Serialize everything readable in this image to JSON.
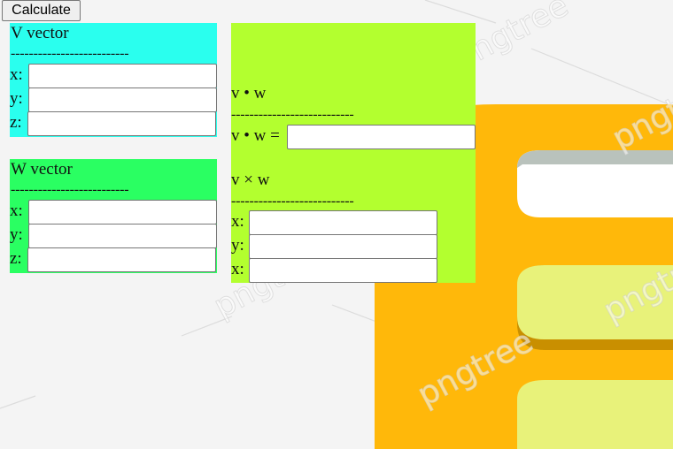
{
  "toolbar": {
    "calculate_label": "Calculate"
  },
  "v_vector": {
    "title": "V vector",
    "divider": "--------------------------",
    "fields": [
      {
        "label": "x:",
        "value": ""
      },
      {
        "label": "y:",
        "value": ""
      },
      {
        "label": "z:",
        "value": ""
      }
    ]
  },
  "w_vector": {
    "title": "W vector",
    "divider": "--------------------------",
    "fields": [
      {
        "label": "x:",
        "value": ""
      },
      {
        "label": "y:",
        "value": ""
      },
      {
        "label": "z:",
        "value": ""
      }
    ]
  },
  "results": {
    "dot": {
      "title": "v • w",
      "divider": "---------------------------",
      "label": "v • w =",
      "value": ""
    },
    "cross": {
      "title": "v × w",
      "divider": "---------------------------",
      "fields": [
        {
          "label": "x:",
          "value": ""
        },
        {
          "label": "y:",
          "value": ""
        },
        {
          "label": "x:",
          "value": ""
        }
      ]
    }
  },
  "colors": {
    "v_panel": "#2affee",
    "w_panel": "#2aff62",
    "result_panel": "#b3ff2f",
    "background_orange": "#ffb80a",
    "background_yellow": "#e8f27a"
  },
  "background": {
    "watermark_text": "pngtree"
  }
}
